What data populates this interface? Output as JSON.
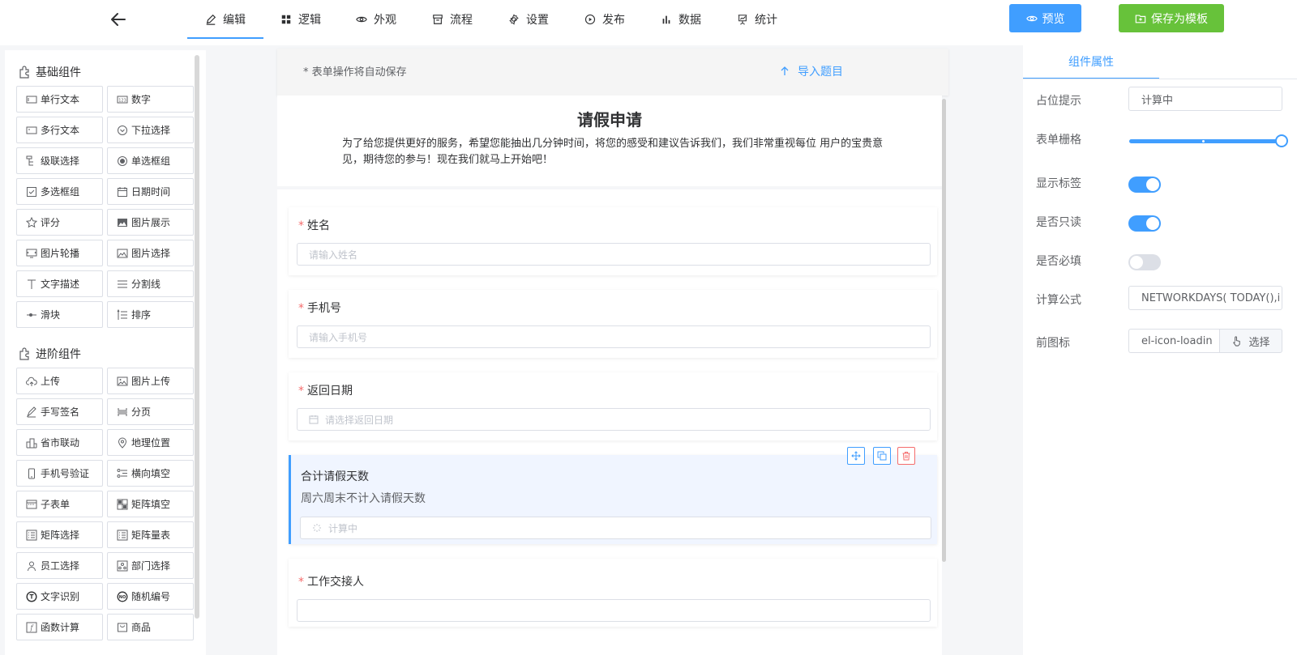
{
  "header": {
    "nav": [
      {
        "label": "编辑",
        "icon": "edit-icon",
        "active": true
      },
      {
        "label": "逻辑",
        "icon": "grid-icon",
        "active": false
      },
      {
        "label": "外观",
        "icon": "eye-icon",
        "active": false
      },
      {
        "label": "流程",
        "icon": "archive-icon",
        "active": false
      },
      {
        "label": "设置",
        "icon": "gear-icon",
        "active": false
      },
      {
        "label": "发布",
        "icon": "play-circle-icon",
        "active": false
      },
      {
        "label": "数据",
        "icon": "bar-chart-icon",
        "active": false
      },
      {
        "label": "统计",
        "icon": "presentation-icon",
        "active": false
      }
    ],
    "preview_label": "预览",
    "save_template_label": "保存为模板"
  },
  "left": {
    "basic_title": "基础组件",
    "basic_items": [
      {
        "label": "单行文本",
        "icon": "input-icon"
      },
      {
        "label": "数字",
        "icon": "number-icon"
      },
      {
        "label": "多行文本",
        "icon": "textarea-icon"
      },
      {
        "label": "下拉选择",
        "icon": "select-icon"
      },
      {
        "label": "级联选择",
        "icon": "cascader-icon"
      },
      {
        "label": "单选框组",
        "icon": "radio-icon"
      },
      {
        "label": "多选框组",
        "icon": "checkbox-icon"
      },
      {
        "label": "日期时间",
        "icon": "calendar-icon"
      },
      {
        "label": "评分",
        "icon": "star-icon"
      },
      {
        "label": "图片展示",
        "icon": "image-icon"
      },
      {
        "label": "图片轮播",
        "icon": "carousel-icon"
      },
      {
        "label": "图片选择",
        "icon": "image-select-icon"
      },
      {
        "label": "文字描述",
        "icon": "text-icon"
      },
      {
        "label": "分割线",
        "icon": "divider-icon"
      },
      {
        "label": "滑块",
        "icon": "slider-icon"
      },
      {
        "label": "排序",
        "icon": "sort-icon"
      }
    ],
    "advanced_title": "进阶组件",
    "advanced_items": [
      {
        "label": "上传",
        "icon": "upload-cloud-icon"
      },
      {
        "label": "图片上传",
        "icon": "image-upload-icon"
      },
      {
        "label": "手写签名",
        "icon": "signature-icon"
      },
      {
        "label": "分页",
        "icon": "pagination-icon"
      },
      {
        "label": "省市联动",
        "icon": "city-icon"
      },
      {
        "label": "地理位置",
        "icon": "location-icon"
      },
      {
        "label": "手机号验证",
        "icon": "phone-icon"
      },
      {
        "label": "横向填空",
        "icon": "fill-blank-icon"
      },
      {
        "label": "子表单",
        "icon": "subform-icon"
      },
      {
        "label": "矩阵填空",
        "icon": "matrix-fill-icon"
      },
      {
        "label": "矩阵选择",
        "icon": "matrix-select-icon"
      },
      {
        "label": "矩阵量表",
        "icon": "matrix-scale-icon"
      },
      {
        "label": "员工选择",
        "icon": "user-icon"
      },
      {
        "label": "部门选择",
        "icon": "department-icon"
      },
      {
        "label": "文字识别",
        "icon": "ocr-icon"
      },
      {
        "label": "随机编号",
        "icon": "random-number-icon"
      },
      {
        "label": "函数计算",
        "icon": "function-icon"
      },
      {
        "label": "商品",
        "icon": "goods-icon"
      }
    ]
  },
  "center": {
    "autosave_note": "* 表单操作将自动保存",
    "import_label": "导入题目",
    "form_title": "请假申请",
    "form_desc": "为了给您提供更好的服务，希望您能抽出几分钟时间，将您的感受和建议告诉我们，我们非常重视每位 用户的宝贵意见，期待您的参与！现在我们就马上开始吧！",
    "fields": [
      {
        "label": "姓名",
        "required": true,
        "placeholder": "请输入姓名"
      },
      {
        "label": "手机号",
        "required": true,
        "placeholder": "请输入手机号"
      },
      {
        "label": "返回日期",
        "required": true,
        "placeholder": "请选择返回日期"
      },
      {
        "label": "合计请假天数",
        "required": false,
        "tip": "周六周末不计入请假天数",
        "placeholder": "计算中"
      },
      {
        "label": "工作交接人",
        "required": true,
        "placeholder": ""
      }
    ]
  },
  "right": {
    "tab_label": "组件属性",
    "placeholder_label": "占位提示",
    "placeholder_value": "计算中",
    "grid_label": "表单栅格",
    "grid_value_fraction": 1,
    "show_label_label": "显示标签",
    "show_label_on": true,
    "readonly_label": "是否只读",
    "readonly_on": true,
    "required_label": "是否必填",
    "required_on": false,
    "formula_label": "计算公式",
    "formula_value": "NETWORKDAYS( TODAY(),i",
    "prefix_icon_label": "前图标",
    "prefix_icon_value": "el-icon-loadin",
    "choose_label": "选择"
  },
  "colors": {
    "primary": "#409eff",
    "success": "#67c23a",
    "danger": "#f56c6c"
  }
}
